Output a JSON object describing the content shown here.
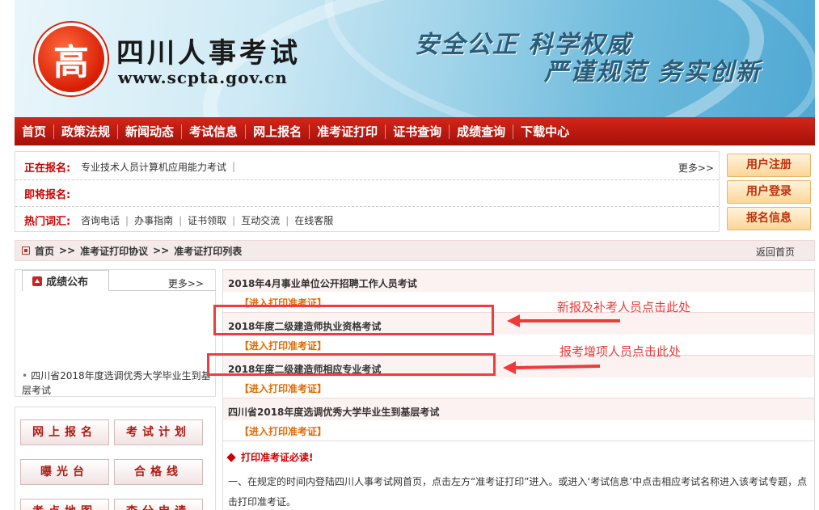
{
  "banner": {
    "logo_glyph": "高",
    "site_name": "四川人事考试",
    "site_url": "www.scpta.gov.cn",
    "slogan1": "安全公正 科学权威",
    "slogan2": "严谨规范 务实创新"
  },
  "nav": [
    "首页",
    "政策法规",
    "新闻动态",
    "考试信息",
    "网上报名",
    "准考证打印",
    "证书查询",
    "成绩查询",
    "下载中心"
  ],
  "info": {
    "r1_label": "正在报名:",
    "r1_text": "专业技术人员计算机应用能力考试",
    "r1_sep": "|",
    "r1_more": "更多>>",
    "r2_label": "即将报名:",
    "r3_label": "热门词汇:",
    "hot": [
      "咨询电话",
      "办事指南",
      "证书领取",
      "互动交流",
      "在线客服"
    ]
  },
  "side_buttons": [
    "用户注册",
    "用户登录",
    "报名信息"
  ],
  "breadcrumb": {
    "items": [
      "首页",
      "准考证打印协议",
      "准考证打印列表"
    ],
    "sep": ">>",
    "back": "返回首页"
  },
  "score": {
    "tab": "成绩公布",
    "more": "更多>>",
    "item": "四川省2018年度选调优秀大学毕业生到基层考试"
  },
  "left_buttons": [
    "网上报名",
    "考试计划",
    "曝光台",
    "合格线",
    "考点地图",
    "查分申请"
  ],
  "exams": [
    {
      "title": "2018年4月事业单位公开招聘工作人员考试",
      "link": "【进入打印准考证】"
    },
    {
      "title": "2018年度二级建造师执业资格考试",
      "link": "【进入打印准考证】"
    },
    {
      "title": "2018年度二级建造师相应专业考试",
      "link": "【进入打印准考证】"
    },
    {
      "title": "四川省2018年度选调优秀大学毕业生到基层考试",
      "link": "【进入打印准考证】"
    }
  ],
  "notice": {
    "title": "打印准考证必读!",
    "body": "一、在规定的时间内登陆四川人事考试网首页，点击左方“准考证打印”进入。或进入‘考试信息’中点击相应考试名称进入该考试专题，点击打印准考证。"
  },
  "annotations": {
    "a1": "新报及补考人员点击此处",
    "a2": "报考增项人员点击此处",
    "color": "#f03a3a"
  }
}
